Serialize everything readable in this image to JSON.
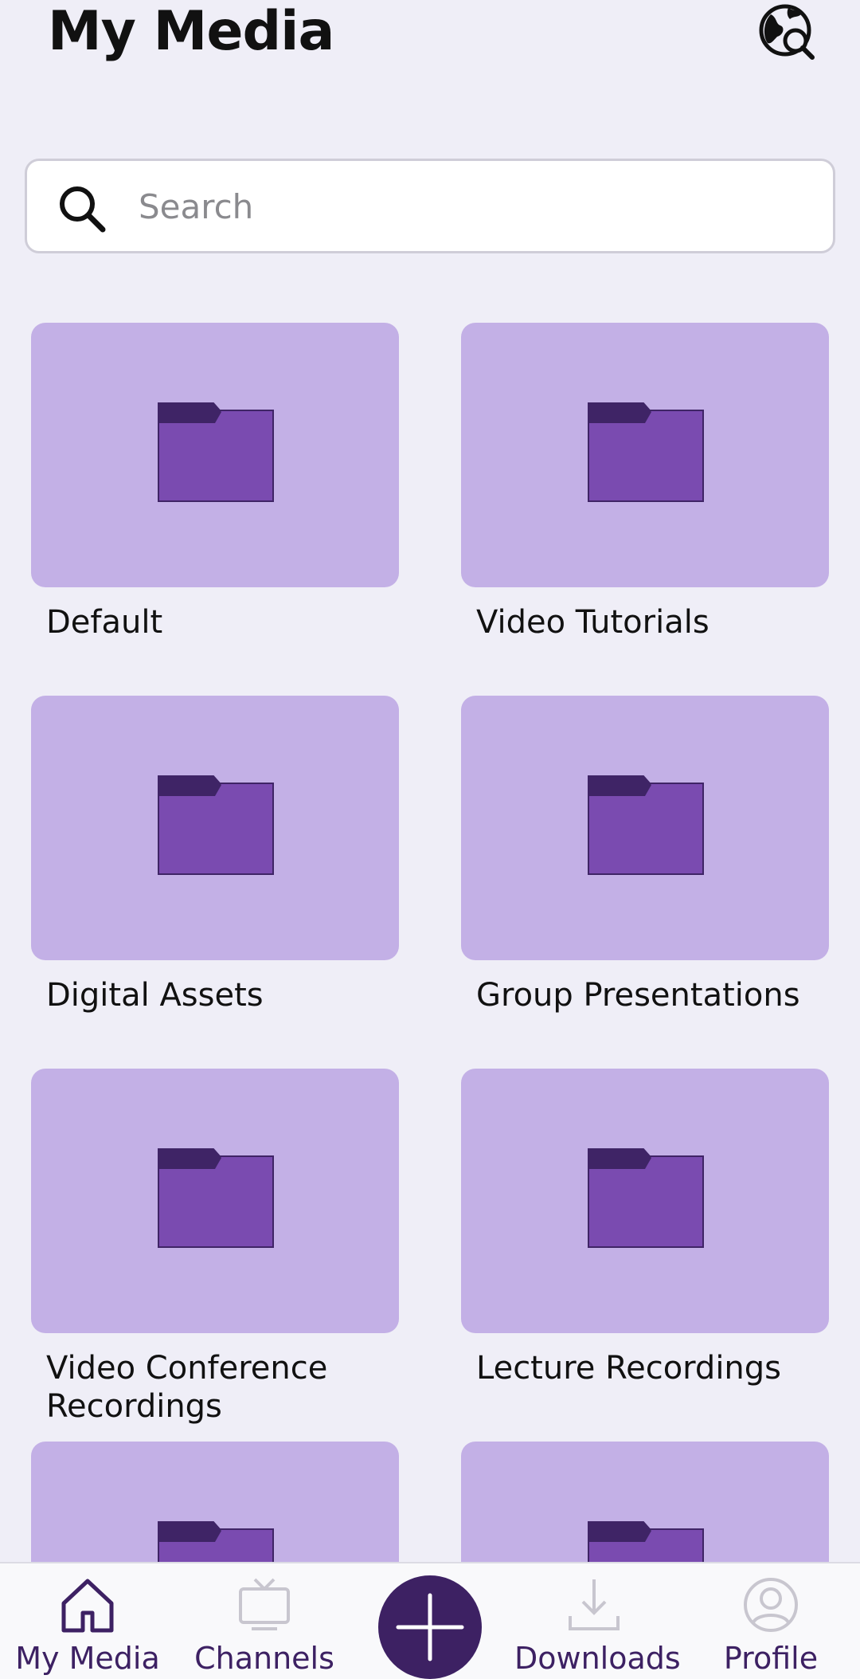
{
  "header": {
    "title": "My Media",
    "globe_icon": "globe-search-icon"
  },
  "search": {
    "placeholder": "Search",
    "value": "",
    "icon": "search-icon"
  },
  "folders": [
    {
      "label": "Default",
      "icon": "folder-icon"
    },
    {
      "label": "Video Tutorials",
      "icon": "folder-icon"
    },
    {
      "label": "Digital Assets",
      "icon": "folder-icon"
    },
    {
      "label": "Group Presentations",
      "icon": "folder-icon"
    },
    {
      "label": "Video Conference Recordings",
      "icon": "folder-icon"
    },
    {
      "label": "Lecture Recordings",
      "icon": "folder-icon"
    },
    {
      "label": "",
      "icon": "folder-icon"
    },
    {
      "label": "",
      "icon": "folder-icon"
    }
  ],
  "tabbar": {
    "tabs": [
      {
        "label": "My Media",
        "icon": "home-icon",
        "active": true
      },
      {
        "label": "Channels",
        "icon": "tv-icon",
        "active": false
      },
      {
        "label": "Downloads",
        "icon": "download-icon",
        "active": false
      },
      {
        "label": "Profile",
        "icon": "user-icon",
        "active": false
      }
    ],
    "add_icon": "plus-icon"
  },
  "colors": {
    "background": "#efeef7",
    "card": "#c3b0e6",
    "folder_body": "#7a4bb0",
    "folder_tab": "#3f2466",
    "accent": "#3d2163",
    "active_tab": "#3d2163",
    "inactive_tab": "#c8c6cf"
  }
}
